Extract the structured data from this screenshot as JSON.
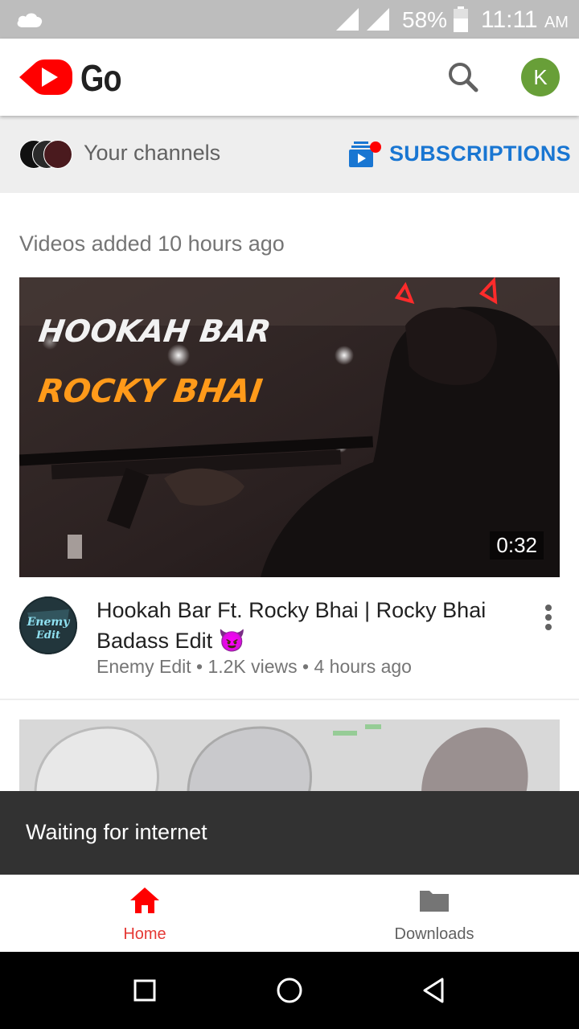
{
  "status_bar": {
    "battery_percent": "58%",
    "time": "11:11",
    "am_pm": "AM"
  },
  "app_bar": {
    "logo_text": "Go",
    "avatar_initial": "K"
  },
  "channels_bar": {
    "your_channels": "Your channels",
    "subscriptions": "SUBSCRIPTIONS"
  },
  "feed": {
    "section_title": "Videos added 10 hours ago",
    "video": {
      "thumbnail_line1": "HOOKAH BAR",
      "thumbnail_line2": "ROCKY BHAI",
      "duration": "0:32",
      "title": "Hookah Bar Ft. Rocky Bhai | Rocky Bhai Badass Edit 😈",
      "meta": "Enemy Edit • 1.2K views • 4 hours ago",
      "channel_avatar_text": "Enemy Edit"
    }
  },
  "snackbar": {
    "message": "Waiting for internet"
  },
  "bottom_nav": {
    "home": "Home",
    "downloads": "Downloads"
  },
  "colors": {
    "brand_red": "#ff0000",
    "accent_blue": "#1976d2",
    "avatar_green": "#689f38"
  }
}
